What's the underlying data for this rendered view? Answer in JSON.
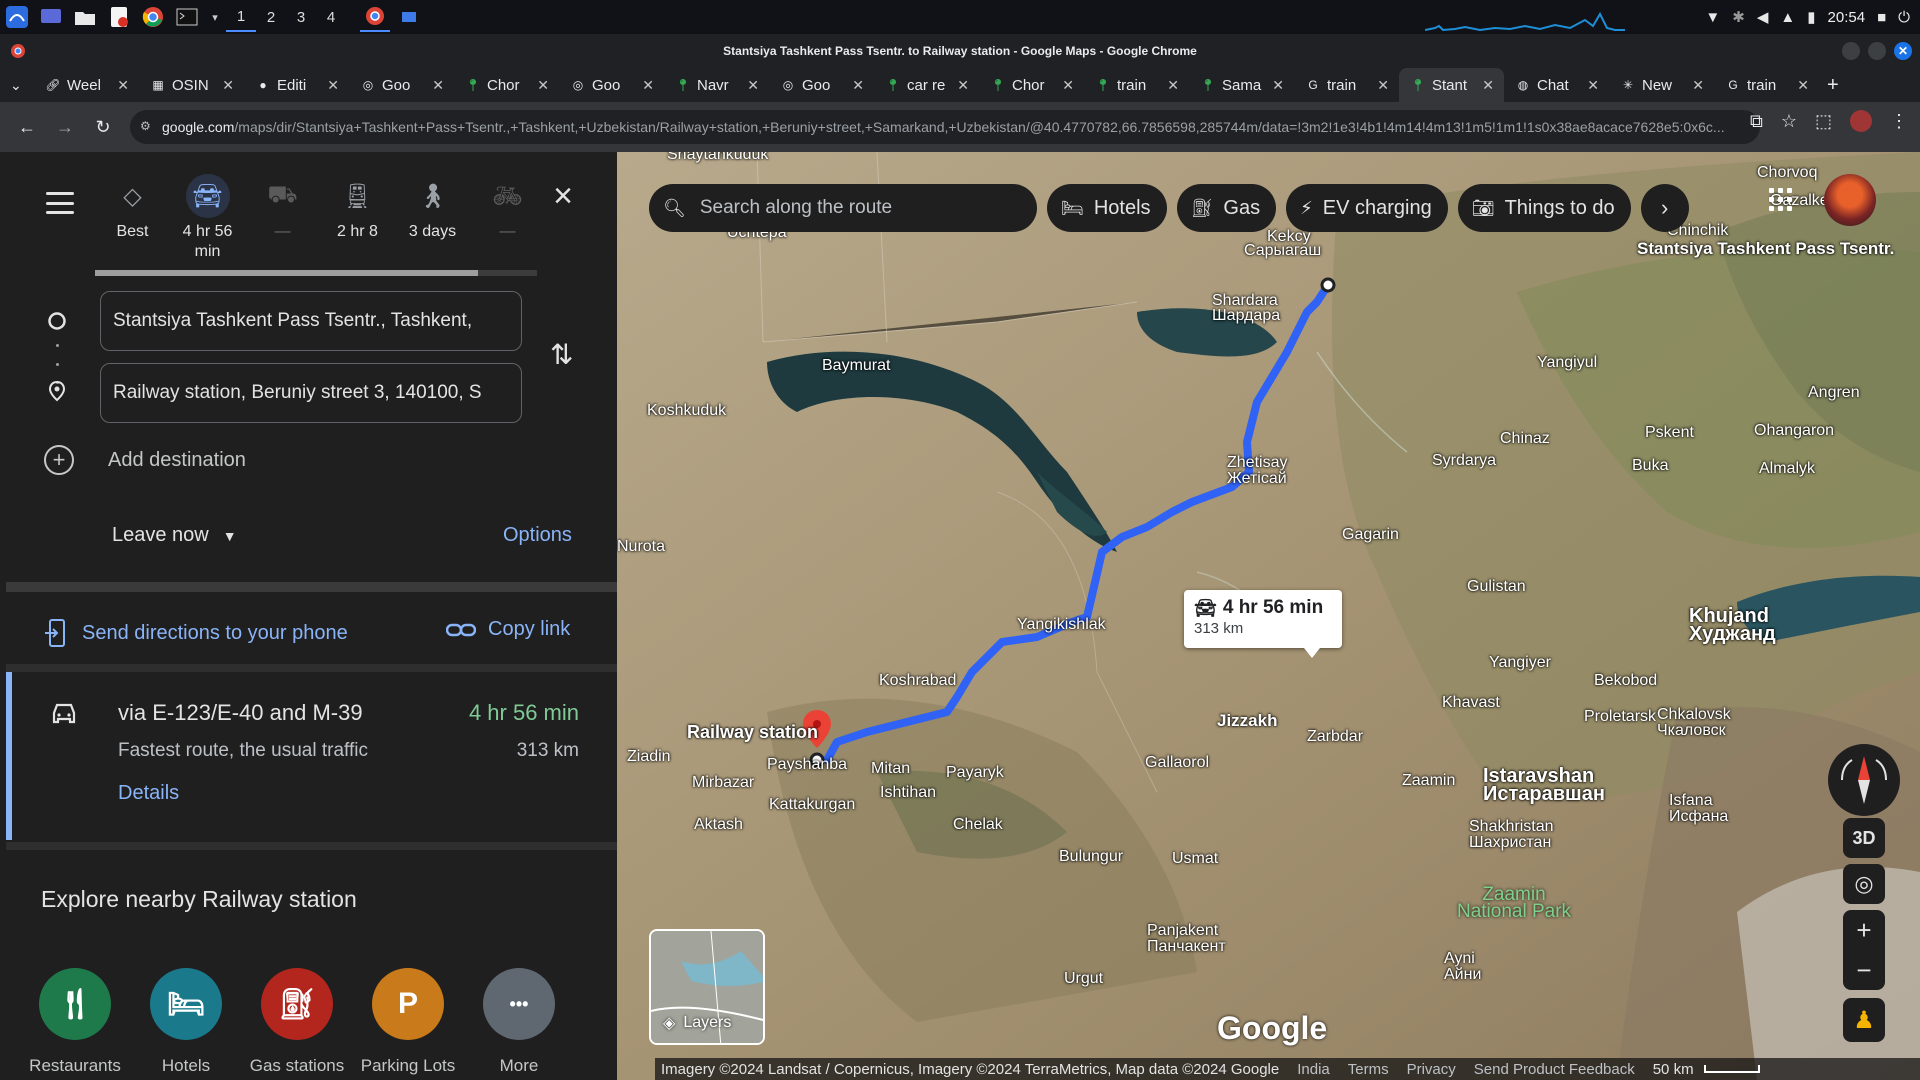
{
  "taskbar": {
    "workspaces": [
      "1",
      "2",
      "3",
      "4"
    ],
    "clock": "20:54"
  },
  "window": {
    "title": "Stantsiya Tashkent Pass Tsentr. to Railway station - Google Maps - Google Chrome"
  },
  "tabs": [
    {
      "title": "Weel",
      "icon": "link-icon"
    },
    {
      "title": "OSIN",
      "icon": "osint-icon"
    },
    {
      "title": "Editi",
      "icon": "github-icon"
    },
    {
      "title": "Goo",
      "icon": "google-lens-icon"
    },
    {
      "title": "Chor",
      "icon": "maps-pin-icon"
    },
    {
      "title": "Goo",
      "icon": "google-lens-icon"
    },
    {
      "title": "Navr",
      "icon": "maps-pin-icon"
    },
    {
      "title": "Goo",
      "icon": "google-lens-icon"
    },
    {
      "title": "car re",
      "icon": "maps-pin-icon"
    },
    {
      "title": "Chor",
      "icon": "maps-pin-icon"
    },
    {
      "title": "train",
      "icon": "maps-pin-icon"
    },
    {
      "title": "Sama",
      "icon": "maps-pin-icon"
    },
    {
      "title": "train",
      "icon": "google-icon"
    },
    {
      "title": "Stant",
      "icon": "maps-pin-icon",
      "active": true
    },
    {
      "title": "Chat",
      "icon": "chatgpt-icon"
    },
    {
      "title": "New",
      "icon": "openai-icon"
    },
    {
      "title": "train",
      "icon": "google-icon"
    }
  ],
  "address_bar": {
    "domain": "google.com",
    "path": "/maps/dir/Stantsiya+Tashkent+Pass+Tsentr.,+Tashkent,+Uzbekistan/Railway+station,+Beruniy+street,+Samarkand,+Uzbekistan/@40.4770782,66.7856598,285744m/data=!3m2!1e3!4b1!4m14!4m13!1m5!1m1!1s0x38ae8acace7628e5:0x6c..."
  },
  "directions": {
    "modes": [
      {
        "label": "Best",
        "icon": "best-route-icon"
      },
      {
        "label": "4 hr 56 min",
        "icon": "car-icon",
        "active": true
      },
      {
        "label": "—",
        "icon": "motorcycle-icon",
        "dim": true
      },
      {
        "label": "2 hr 8",
        "icon": "train-icon"
      },
      {
        "label": "3 days",
        "icon": "walk-icon"
      },
      {
        "label": "—",
        "icon": "bicycle-icon",
        "dim": true
      }
    ],
    "origin": "Stantsiya Tashkent Pass Tsentr., Tashkent,",
    "destination": "Railway station, Beruniy street 3, 140100, S",
    "add_destination": "Add destination",
    "leave_now": "Leave now",
    "options": "Options",
    "send_to_phone": "Send directions to your phone",
    "copy_link": "Copy link",
    "route": {
      "via": "via E-123/E-40 and M-39",
      "time": "4 hr 56 min",
      "description": "Fastest route, the usual traffic",
      "distance": "313 km",
      "details": "Details"
    },
    "explore_title": "Explore nearby Railway station",
    "categories": [
      {
        "label": "Restaurants",
        "icon": "restaurant-icon",
        "color": "#1e7a4a"
      },
      {
        "label": "Hotels",
        "icon": "hotel-icon",
        "color": "#1a7a8c"
      },
      {
        "label": "Gas stations",
        "icon": "gas-station-icon",
        "color": "#b3261e"
      },
      {
        "label": "Parking Lots",
        "icon": "parking-icon",
        "color": "#c97a1a"
      },
      {
        "label": "More",
        "icon": "more-icon",
        "color": "#5f6770"
      }
    ]
  },
  "map": {
    "search_placeholder": "Search along the route",
    "chips": [
      "Hotels",
      "Gas",
      "EV charging",
      "Things to do"
    ],
    "route_box": {
      "time": "4 hr 56 min",
      "distance": "313 km"
    },
    "origin_label": "Stantsiya Tashkent Pass Tsentr.",
    "destination_label": "Railway station",
    "places": [
      "Shaytankuduk",
      "Uchtepa",
      "Chorvoq",
      "Gazalkent",
      "Kekcy",
      "Сарыагаш",
      "Chinchik",
      "Shardara",
      "Шардара",
      "Baymurat",
      "Yangiyul",
      "Angren",
      "Koshkuduk",
      "Chinaz",
      "Pskent",
      "Ohangaron",
      "Syrdarya",
      "Buka",
      "Almalyk",
      "Zhetisay",
      "Жетісай",
      "Gagarin",
      "Nurota",
      "Gulistan",
      "Yangikishlak",
      "Khujand",
      "Худжанд",
      "Yangiyer",
      "Koshrabad",
      "Bekobod",
      "Khavast",
      "Proletarsk",
      "Chkalovsk",
      "Чкаловск",
      "Jizzakh",
      "Zarbdar",
      "Ziadin",
      "Payshanba",
      "Mitan",
      "Payaryk",
      "Gallaorol",
      "Zaamin",
      "Istaravshan",
      "Истаравшан",
      "Mirbazar",
      "Ishtihan",
      "Kattakurgan",
      "Isfana",
      "Исфана",
      "Aktash",
      "Chelak",
      "Shakhristan",
      "Шахристан",
      "Bulungur",
      "Usmat",
      "Zaamin National Park",
      "Panjakent",
      "Панчакент",
      "Urgut",
      "Ayni",
      "Айни"
    ],
    "layers_label": "Layers",
    "controls": {
      "three_d": "3D"
    },
    "logo": "Google",
    "attribution": "Imagery ©2024 Landsat / Copernicus, Imagery ©2024 TerraMetrics, Map data ©2024 Google",
    "footer_links": [
      "India",
      "Terms",
      "Privacy",
      "Send Product Feedback"
    ],
    "scale": "50 km"
  },
  "colors": {
    "route_blue": "#2f62f5",
    "link_blue": "#8ab4f8",
    "time_green": "#81c995",
    "panel_bg": "#1f1f1f"
  }
}
